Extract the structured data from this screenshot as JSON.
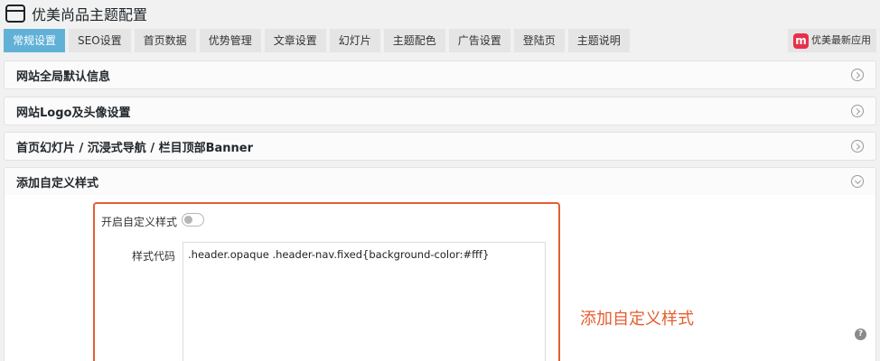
{
  "page": {
    "title": "优美尚品主题配置"
  },
  "tabs": [
    {
      "label": "常规设置",
      "active": true
    },
    {
      "label": "SEO设置"
    },
    {
      "label": "首页数据"
    },
    {
      "label": "优势管理"
    },
    {
      "label": "文章设置"
    },
    {
      "label": "幻灯片"
    },
    {
      "label": "主题配色"
    },
    {
      "label": "广告设置"
    },
    {
      "label": "登陆页"
    },
    {
      "label": "主题说明"
    }
  ],
  "app_button": {
    "logo": "m",
    "label": "优美最新应用"
  },
  "panels": [
    {
      "title": "网站全局默认信息",
      "state": "collapsed"
    },
    {
      "title": "网站Logo及头像设置",
      "state": "collapsed"
    },
    {
      "title": "首页幻灯片 / 沉浸式导航 / 栏目顶部Banner",
      "state": "collapsed"
    },
    {
      "title": "添加自定义样式",
      "state": "expanded"
    }
  ],
  "custom_style": {
    "enable_label": "开启自定义样式",
    "enabled": false,
    "code_label": "样式代码",
    "code_value": ".header.opaque .header-nav.fixed{background-color:#fff}"
  },
  "annotation": {
    "text": "添加自定义样式",
    "color": "#e55d2f"
  },
  "help_icon": "?",
  "colors": {
    "active_tab": "#61b1d7",
    "annotation": "#e55d2f",
    "app_logo": "#e8304a"
  }
}
